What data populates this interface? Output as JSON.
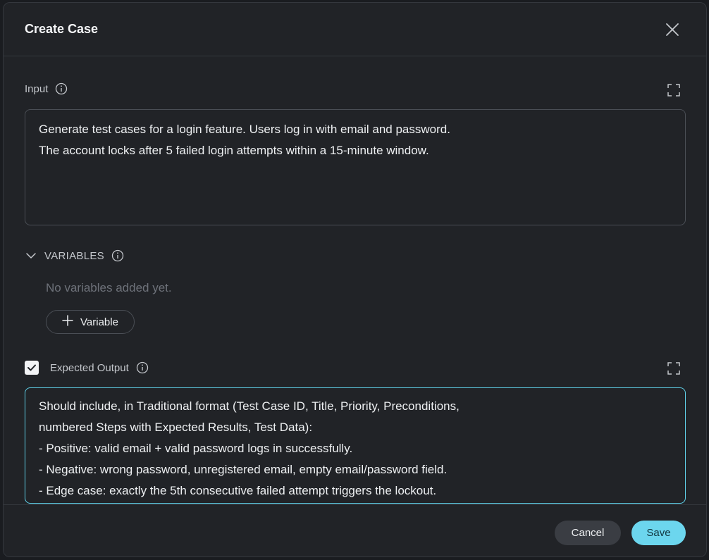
{
  "modal": {
    "title": "Create Case"
  },
  "input": {
    "label": "Input",
    "value": "Generate test cases for a login feature. Users log in with email and password.\nThe account locks after 5 failed login attempts within a 15-minute window."
  },
  "variables": {
    "title": "VARIABLES",
    "empty_text": "No variables added yet.",
    "add_label": "Variable"
  },
  "expected_output": {
    "checked": true,
    "label": "Expected Output",
    "value": "Should include, in Traditional format (Test Case ID, Title, Priority, Preconditions,\nnumbered Steps with Expected Results, Test Data):\n- Positive: valid email + valid password logs in successfully.\n- Negative: wrong password, unregistered email, empty email/password field.\n- Edge case: exactly the 5th consecutive failed attempt triggers the lockout."
  },
  "footer": {
    "cancel_label": "Cancel",
    "save_label": "Save"
  },
  "icons": {
    "close": "close-icon",
    "info": "info-icon",
    "expand": "expand-icon",
    "chevron": "chevron-down-icon",
    "plus": "plus-icon",
    "check": "check-icon"
  },
  "colors": {
    "accent": "#6cd6ee",
    "modal_bg": "#212327",
    "border": "#34373d"
  }
}
